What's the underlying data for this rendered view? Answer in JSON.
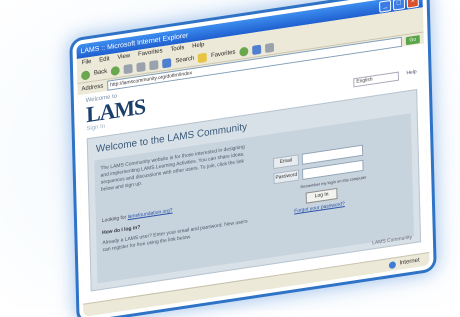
{
  "browser": {
    "title": "LAMS :: Microsoft Internet Explorer",
    "menu": [
      "File",
      "Edit",
      "View",
      "Favorites",
      "Tools",
      "Help"
    ],
    "toolbar": {
      "back_label": "Back",
      "search_label": "Search",
      "favorites_label": "Favorites"
    },
    "address_label": "Address",
    "address_value": "http://lamscommunity.org/dotlrn/index",
    "go_label": "Go",
    "status_zone": "Internet"
  },
  "page": {
    "logo_small": "Welcome to",
    "logo": "LAMS",
    "logo_sub": "Sign In",
    "language_select": "English",
    "help_link": "Help",
    "welcome_title": "Welcome to the LAMS Community",
    "intro_text": "The LAMS Community website is for those interested in designing and implementing LAMS Learning Activities. You can share ideas, sequences and discussions with other users. To join, click the link below and sign up.",
    "looking_prefix": "Looking for",
    "looking_link": "lamsfoundation.org?",
    "howto_heading": "How do I log in?",
    "extra_text": "Already a LAMS user? Enter your email and password. New users can register for free using the link below.",
    "login": {
      "email_label": "Email",
      "password_label": "Password",
      "remember_text": "Remember my login on this computer",
      "button": "Log In",
      "forgot_link": "Forgot your password?"
    },
    "footer": "LAMS Community"
  }
}
